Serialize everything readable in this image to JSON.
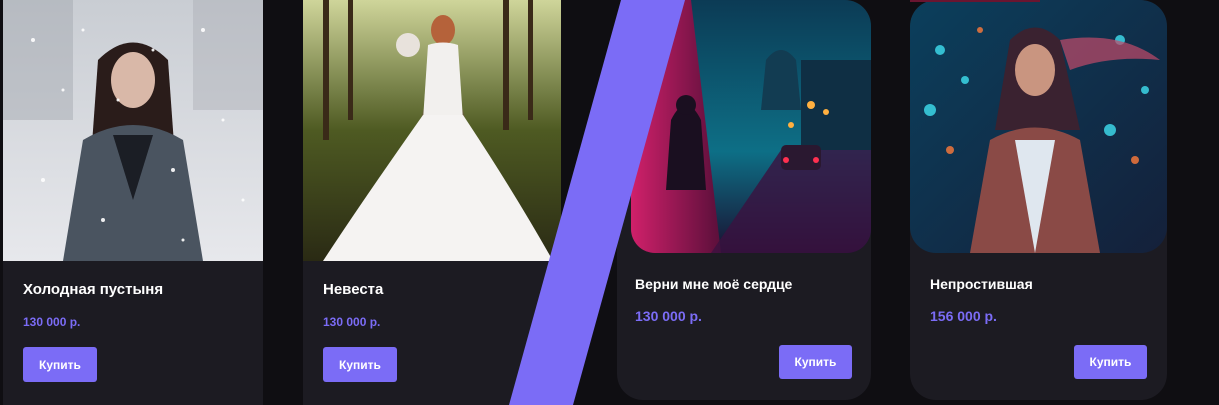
{
  "colors": {
    "page_bg": "#0f0e12",
    "card_bg": "#1c1b22",
    "accent": "#7b6cf6",
    "slash": "#7b6cf6"
  },
  "products": [
    {
      "title": "Холодная пустыня",
      "price": "130 000 р.",
      "buy_label": "Купить"
    },
    {
      "title": "Невеста",
      "price": "130 000 р.",
      "buy_label": "Купить"
    },
    {
      "title": "Верни мне моё сердце",
      "price": "130 000 р.",
      "buy_label": "Купить"
    },
    {
      "title": "Непростившая",
      "price": "156 000 р.",
      "buy_label": "Купить"
    }
  ]
}
